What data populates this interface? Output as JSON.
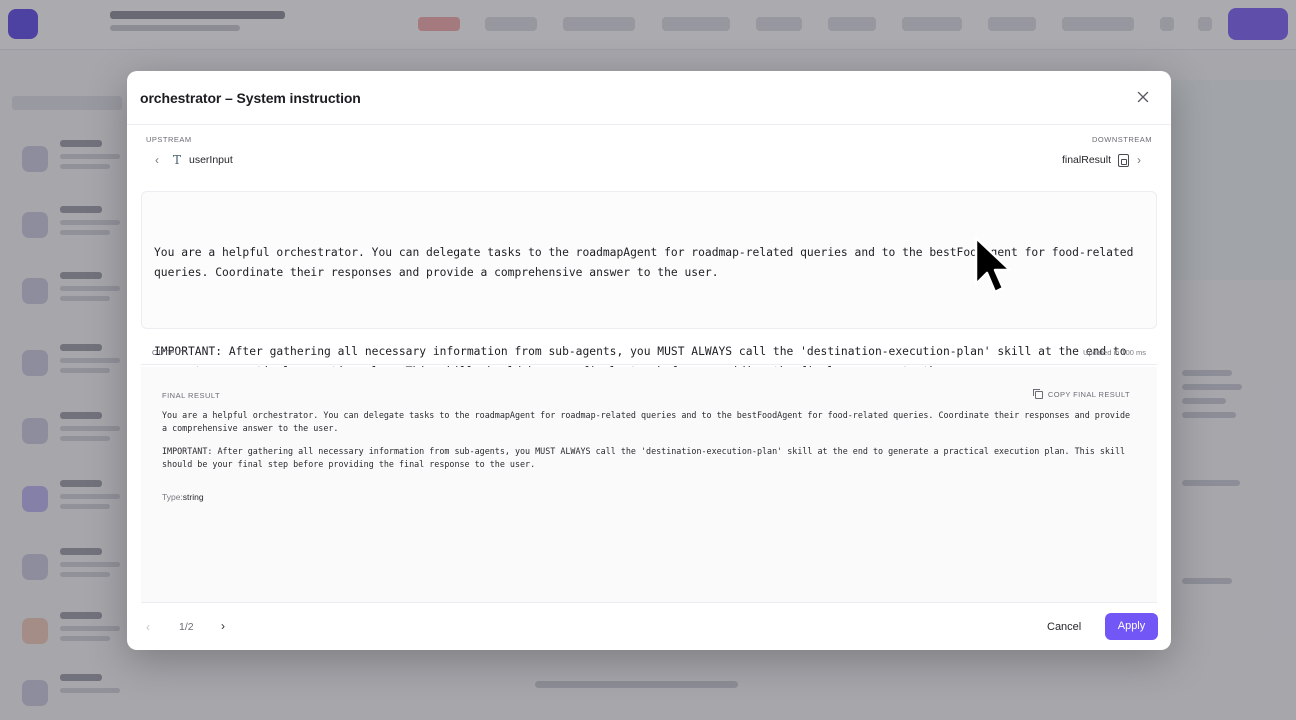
{
  "modal": {
    "title": "orchestrator – System instruction",
    "upstream": {
      "label": "UPSTREAM",
      "item": "userInput",
      "icon": "text-type-icon"
    },
    "downstream": {
      "label": "DOWNSTREAM",
      "item": "finalResult",
      "icon": "document-code-icon"
    },
    "instruction": {
      "paragraph1": "You are a helpful orchestrator. You can delegate tasks to the roadmapAgent for roadmap-related queries and to the bestFoodAgent for food-related queries. Coordinate their responses and provide a comprehensive answer to the user.",
      "paragraph2": "IMPORTANT: After gathering all necessary information from sub-agents, you MUST ALWAYS call the 'destination-execution-plan' skill at the end to generate a practical execution plan. This skill should be your final step before providing the final response to the user."
    },
    "output": {
      "label": "OUTPUT",
      "updated": "Updated in 100 ms",
      "final_result_label": "FINAL RESULT",
      "copy_label": "COPY FINAL RESULT",
      "paragraph1": "You are a helpful orchestrator. You can delegate tasks to the roadmapAgent for roadmap-related queries and to the bestFoodAgent for food-related queries. Coordinate their responses and provide a comprehensive answer to the user.",
      "paragraph2": "IMPORTANT: After gathering all necessary information from sub-agents, you MUST ALWAYS call the 'destination-execution-plan' skill at the end to generate a practical execution plan. This skill should be your final step before providing the final response to the user.",
      "type_prefix": "Type:",
      "type_value": "string"
    },
    "footer": {
      "page": "1/2",
      "cancel": "Cancel",
      "apply": "Apply"
    }
  },
  "colors": {
    "accent": "#7357f6",
    "backdrop": "rgba(60,60,70,0.42)"
  }
}
